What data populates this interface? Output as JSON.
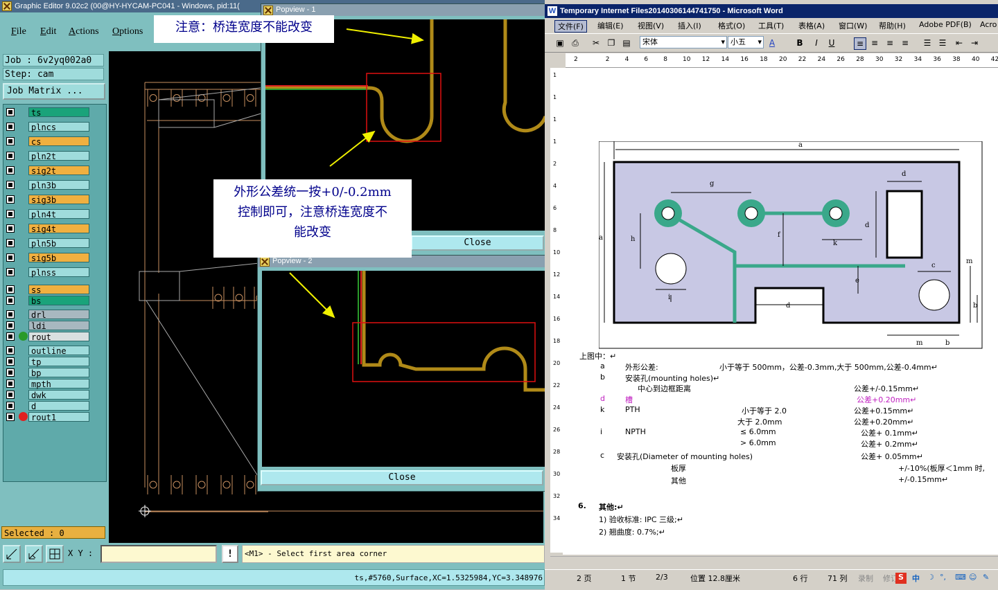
{
  "graphic_editor": {
    "title": "Graphic Editor 9.02c2 (00@HY-HYCAM-PC041 - Windows, pid:11(",
    "menu": [
      "File",
      "Edit",
      "Actions",
      "Options"
    ],
    "job": "Job : 6v2yq002a0",
    "step": "Step: cam",
    "job_matrix_button": "Job Matrix ...",
    "layers": [
      {
        "name": "ts",
        "color": "#1aa37a",
        "dot": ""
      },
      {
        "name": "plncs",
        "color": "#9fdcdc",
        "dot": ""
      },
      {
        "name": "cs",
        "color": "#f0b040",
        "dot": ""
      },
      {
        "name": "pln2t",
        "color": "#9fdcdc",
        "dot": ""
      },
      {
        "name": "sig2t",
        "color": "#f0b040",
        "dot": ""
      },
      {
        "name": "pln3b",
        "color": "#9fdcdc",
        "dot": ""
      },
      {
        "name": "sig3b",
        "color": "#f0b040",
        "dot": ""
      },
      {
        "name": "pln4t",
        "color": "#9fdcdc",
        "dot": ""
      },
      {
        "name": "sig4t",
        "color": "#f0b040",
        "dot": ""
      },
      {
        "name": "pln5b",
        "color": "#9fdcdc",
        "dot": ""
      },
      {
        "name": "sig5b",
        "color": "#f0b040",
        "dot": ""
      },
      {
        "name": "plnss",
        "color": "#9fdcdc",
        "dot": ""
      },
      {
        "name": "ss",
        "color": "#f0b040",
        "dot": ""
      },
      {
        "name": "bs",
        "color": "#1aa37a",
        "dot": ""
      },
      {
        "name": "drl",
        "color": "#a8b8c0",
        "dot": ""
      },
      {
        "name": "ldi",
        "color": "#a8b8c0",
        "dot": ""
      },
      {
        "name": "rout",
        "color": "#d8e0e0",
        "dot": "#2a9a2a"
      },
      {
        "name": "outline",
        "color": "#9fdcdc",
        "dot": ""
      },
      {
        "name": "tp",
        "color": "#9fdcdc",
        "dot": ""
      },
      {
        "name": "bp",
        "color": "#9fdcdc",
        "dot": ""
      },
      {
        "name": "mpth",
        "color": "#9fdcdc",
        "dot": ""
      },
      {
        "name": "dwk",
        "color": "#9fdcdc",
        "dot": ""
      },
      {
        "name": "d",
        "color": "#9fdcdc",
        "dot": ""
      },
      {
        "name": "rout1",
        "color": "#9fdcdc",
        "dot": "#e02020"
      }
    ],
    "selected": "Selected : 0",
    "xy_label": "X Y :",
    "bang": "!",
    "message": "<M1> - Select first area corner",
    "status": "ts,#5760,Surface,XC=1.5325984,YC=3.348976"
  },
  "popviews": [
    {
      "title": "Popview - 1",
      "close": "Close"
    },
    {
      "title": "Popview - 2",
      "close": "Close"
    }
  ],
  "callouts": {
    "top": "注意：桥连宽度不能改变",
    "middle_line1": "外形公差统一按+0/-0.2mm",
    "middle_line2": "控制即可，注意桥连宽度不",
    "middle_line3": "能改变"
  },
  "word": {
    "title": "Temporary Internet Files20140306144741750 - Microsoft Word",
    "menu": [
      "文件(F)",
      "编辑(E)",
      "视图(V)",
      "插入(I)",
      "格式(O)",
      "工具(T)",
      "表格(A)",
      "窗口(W)",
      "帮助(H)",
      "Adobe PDF(B)",
      "Acro"
    ],
    "font_name": "宋体",
    "font_size": "小五",
    "ruler_ticks": [
      "2",
      "2",
      "4",
      "6",
      "8",
      "10",
      "12",
      "14",
      "16",
      "18",
      "20",
      "22",
      "24",
      "26",
      "28",
      "30",
      "32",
      "34",
      "36",
      "38",
      "40",
      "42"
    ],
    "vruler_ticks": [
      "1",
      "1",
      "1",
      "1",
      "2",
      "4",
      "6",
      "8",
      "10",
      "12",
      "14",
      "16",
      "18",
      "20",
      "22",
      "24",
      "26",
      "28",
      "30",
      "32",
      "34"
    ],
    "diagram_labels": {
      "a_top": "a",
      "a_left": "a",
      "g": "g",
      "d_top": "d",
      "d_right": "d",
      "h": "h",
      "f": "f",
      "k": "k",
      "i": "i",
      "e": "e",
      "c": "c",
      "m_right": "m",
      "b_right": "b",
      "d_slot": "d",
      "m_bottom": "m",
      "b_bottom": "b"
    },
    "doc_lines": [
      {
        "c1": "上图中：↵",
        "c2": "",
        "c3": "",
        "c4": ""
      },
      {
        "c1": "a",
        "c2": "外形公差:",
        "c3": "小于等于 500mm，公差-0.3mm,大于 500mm,公差-0.4mm↵",
        "c4": ""
      },
      {
        "c1": "b",
        "c2": "安装孔(mounting holes)↵",
        "c3": "",
        "c4": ""
      },
      {
        "c1": "",
        "c2": "中心到边框距离",
        "c3": "",
        "c4": "公差+/-0.15mm↵"
      },
      {
        "c1": "d",
        "c2": "槽",
        "c3": "",
        "c4": "公差+0.20mm↵"
      },
      {
        "c1": "k",
        "c2": "PTH",
        "c3": "小于等于 2.0",
        "c4": "公差+0.15mm↵"
      },
      {
        "c1": "",
        "c2": "",
        "c3": "大于 2.0mm",
        "c4": "公差+0.20mm↵"
      },
      {
        "c1": "i",
        "c2": "NPTH",
        "c3": "≤ 6.0mm",
        "c4": "公差+ 0.1mm↵"
      },
      {
        "c1": "",
        "c2": "",
        "c3": "> 6.0mm",
        "c4": "公差+ 0.2mm↵"
      },
      {
        "c1": "c",
        "c2": "安装孔(Diameter of mounting holes)",
        "c3": "",
        "c4": "公差+ 0.05mm↵"
      },
      {
        "c1": "",
        "c2": "板厚",
        "c3": "",
        "c4": "+/-10%(板厚＜1mm 时,"
      },
      {
        "c1": "",
        "c2": "其他",
        "c3": "",
        "c4": "+/-0.15mm↵"
      }
    ],
    "section": {
      "num": "6.",
      "title": "其他:↵"
    },
    "items": [
      "1)  验收标准: IPC 三级;↵",
      "2)  翘曲度: 0.7%;↵"
    ],
    "status": {
      "page": "2 页",
      "section": "1 节",
      "pages": "2/3",
      "position": "位置 12.8厘米",
      "line": "6 行",
      "col": "71 列",
      "rec": "录制",
      "trk": "修订"
    },
    "ime": "中"
  }
}
